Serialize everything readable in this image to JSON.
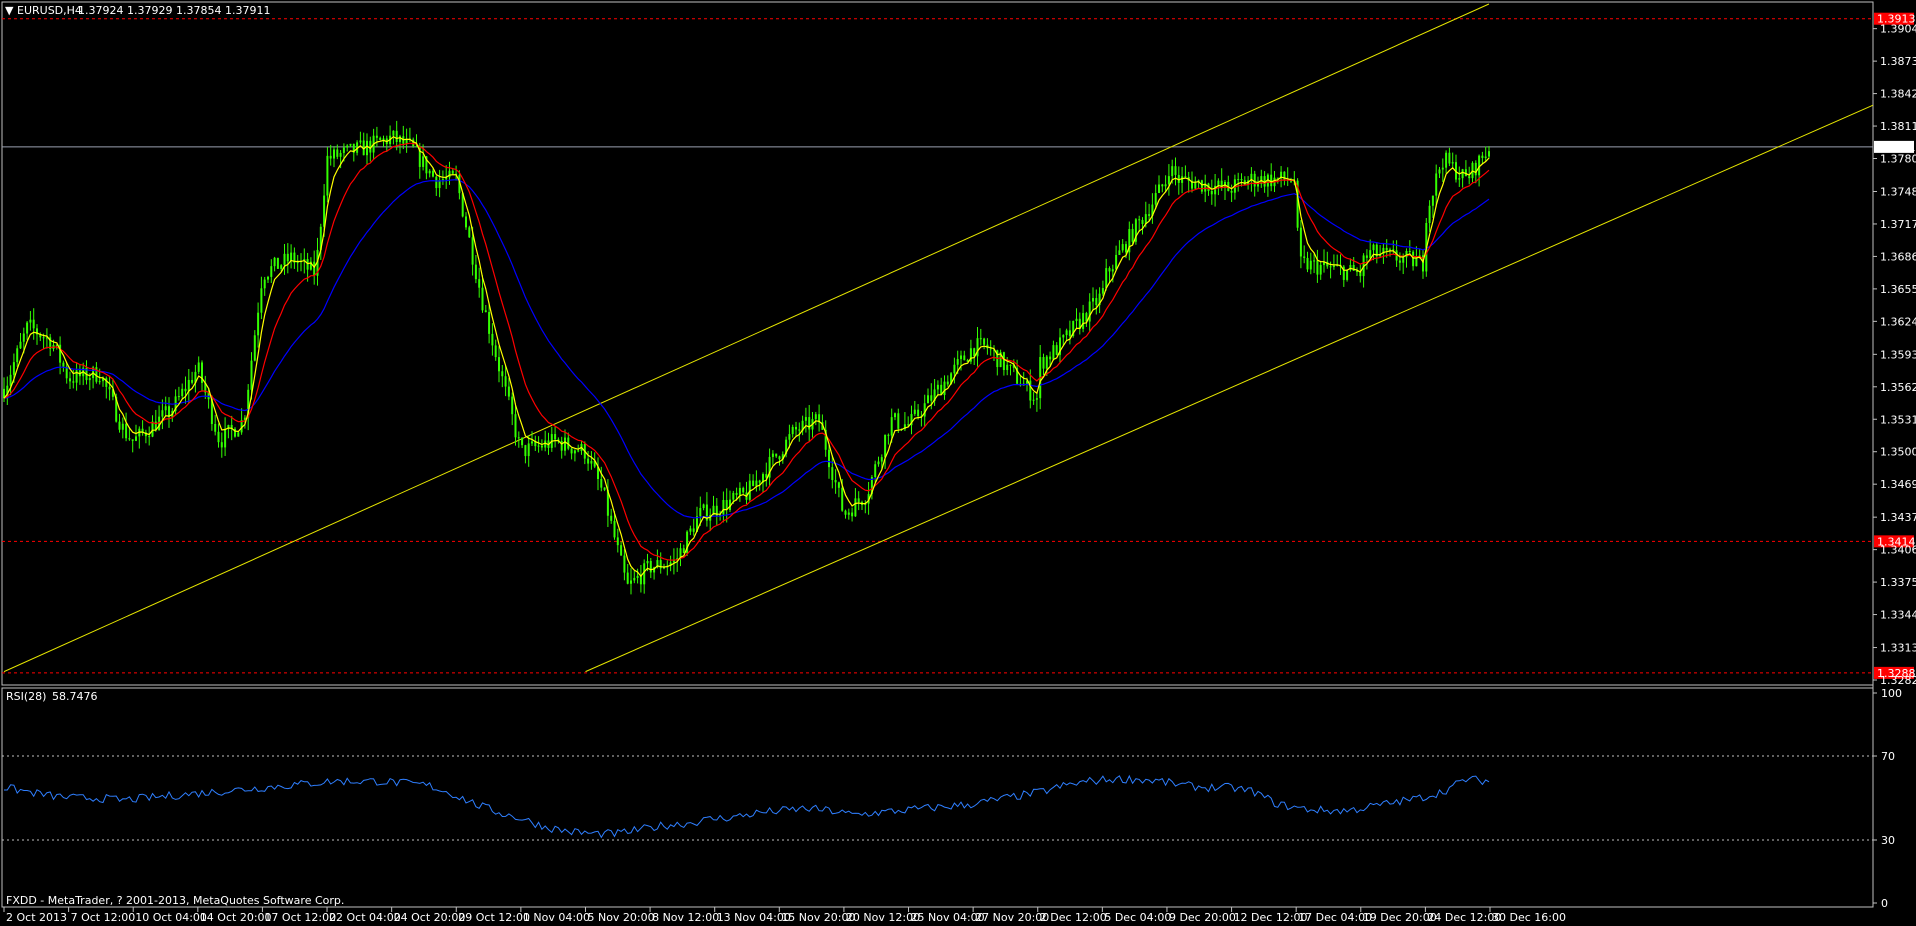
{
  "colors": {
    "background": "#000000",
    "candles": "#33ff00",
    "grid_axis": "#c0c0c0",
    "ma_fast": "#ffff00",
    "ma_mid": "#ff0000",
    "ma_slow": "#0000ff",
    "channel": "#e6e600",
    "rsi": "#2f7fff",
    "hline_red": "#ff0000",
    "price_box": "#ffffff",
    "red_box": "#ff0000"
  },
  "header": {
    "symbol_label": "EURUSD,H4",
    "ohlc_text": "1.37924 1.37929 1.37854 1.37911"
  },
  "rsi_panel": {
    "label": "RSI(28)",
    "value": "58.7476",
    "ticks": [
      "100",
      "70",
      "30",
      "0"
    ],
    "levels": [
      70,
      30
    ]
  },
  "footer_text": "FXDD - MetaTrader, ? 2001-2013, MetaQuotes Software Corp.",
  "chart_data": {
    "type": "candlestick",
    "symbol": "EURUSD",
    "timeframe": "H4",
    "ylim": [
      1.3282,
      1.3918
    ],
    "y_ticks": [
      "1.39040",
      "1.38730",
      "1.38420",
      "1.38110",
      "1.37800",
      "1.37485",
      "1.37175",
      "1.36865",
      "1.36555",
      "1.36245",
      "1.35930",
      "1.35620",
      "1.35310",
      "1.35000",
      "1.34690",
      "1.34375",
      "1.34065",
      "1.33755",
      "1.33445",
      "1.33130",
      "1.32820"
    ],
    "x_ticks": [
      "2 Oct 2013",
      "7 Oct 12:00",
      "10 Oct 04:00",
      "14 Oct 20:00",
      "17 Oct 12:00",
      "22 Oct 04:00",
      "24 Oct 20:00",
      "29 Oct 12:00",
      "1 Nov 04:00",
      "5 Nov 20:00",
      "8 Nov 12:00",
      "13 Nov 04:00",
      "15 Nov 20:00",
      "20 Nov 12:00",
      "25 Nov 04:00",
      "27 Nov 20:00",
      "2 Dec 12:00",
      "5 Dec 04:00",
      "9 Dec 20:00",
      "12 Dec 12:00",
      "17 Dec 04:00",
      "19 Dec 20:00",
      "24 Dec 12:00",
      "30 Dec 16:00"
    ],
    "close_path": [
      [
        "2 Oct 2013",
        1.356
      ],
      [
        "3 Oct 2013",
        1.362
      ],
      [
        "4 Oct 2013",
        1.3605
      ],
      [
        "7 Oct 12:00",
        1.357
      ],
      [
        "8 Oct 2013",
        1.3575
      ],
      [
        "9 Oct 2013",
        1.352
      ],
      [
        "10 Oct 04:00",
        1.351
      ],
      [
        "11 Oct 2013",
        1.354
      ],
      [
        "14 Oct 20:00",
        1.358
      ],
      [
        "15 Oct 2013",
        1.351
      ],
      [
        "16 Oct 2013",
        1.353
      ],
      [
        "17 Oct 12:00",
        1.367
      ],
      [
        "18 Oct 2013",
        1.3685
      ],
      [
        "21 Oct 2013",
        1.367
      ],
      [
        "22 Oct 04:00",
        1.378
      ],
      [
        "23 Oct 2013",
        1.379
      ],
      [
        "24 Oct 20:00",
        1.38
      ],
      [
        "25 Oct 2013",
        1.379
      ],
      [
        "28 Oct 2013",
        1.376
      ],
      [
        "29 Oct 12:00",
        1.376
      ],
      [
        "30 Oct 2013",
        1.364
      ],
      [
        "31 Oct 2013",
        1.355
      ],
      [
        "1 Nov 04:00",
        1.35
      ],
      [
        "4 Nov 2013",
        1.351
      ],
      [
        "5 Nov 20:00",
        1.35
      ],
      [
        "6 Nov 2013",
        1.346
      ],
      [
        "7 Nov 2013",
        1.337
      ],
      [
        "8 Nov 12:00",
        1.339
      ],
      [
        "11 Nov 2013",
        1.3395
      ],
      [
        "12 Nov 2013",
        1.344
      ],
      [
        "13 Nov 04:00",
        1.3445
      ],
      [
        "14 Nov 2013",
        1.346
      ],
      [
        "15 Nov 20:00",
        1.35
      ],
      [
        "18 Nov 2013",
        1.352
      ],
      [
        "19 Nov 2013",
        1.353
      ],
      [
        "20 Nov 12:00",
        1.344
      ],
      [
        "21 Nov 2013",
        1.346
      ],
      [
        "22 Nov 2013",
        1.353
      ],
      [
        "25 Nov 04:00",
        1.3525
      ],
      [
        "26 Nov 2013",
        1.356
      ],
      [
        "27 Nov 20:00",
        1.36
      ],
      [
        "28 Nov 2013",
        1.36
      ],
      [
        "2 Dec 12:00",
        1.355
      ],
      [
        "3 Dec 2013",
        1.358
      ],
      [
        "4 Dec 2013",
        1.36
      ],
      [
        "5 Dec 04:00",
        1.365
      ],
      [
        "6 Dec 2013",
        1.367
      ],
      [
        "9 Dec 20:00",
        1.376
      ],
      [
        "10 Dec 2013",
        1.379
      ],
      [
        "11 Dec 2013",
        1.376
      ],
      [
        "12 Dec 12:00",
        1.375
      ],
      [
        "13 Dec 2013",
        1.375
      ],
      [
        "16 Dec 2013",
        1.376
      ],
      [
        "17 Dec 04:00",
        1.376
      ],
      [
        "18 Dec 2013",
        1.368
      ],
      [
        "19 Dec 20:00",
        1.367
      ],
      [
        "20 Dec 2013",
        1.366
      ],
      [
        "23 Dec 2013",
        1.369
      ],
      [
        "24 Dec 12:00",
        1.368
      ],
      [
        "26 Dec 2013",
        1.37
      ],
      [
        "27 Dec 2013",
        1.378
      ],
      [
        "30 Dec 2013",
        1.376
      ],
      [
        "30 Dec 16:00",
        1.37911
      ]
    ],
    "rsi_path": [
      55,
      53,
      51,
      50,
      50,
      49,
      50,
      51,
      52,
      53,
      54,
      55,
      56,
      57,
      58,
      58,
      58,
      57,
      56,
      52,
      47,
      43,
      40,
      36,
      34,
      33,
      33,
      35,
      37,
      38,
      40,
      41,
      43,
      44,
      45,
      44,
      42,
      43,
      44,
      45,
      46,
      47,
      49,
      51,
      53,
      56,
      58,
      59,
      59,
      58,
      56,
      55,
      55,
      53,
      47,
      45,
      44,
      44,
      46,
      48,
      50,
      53,
      59,
      58
    ],
    "current_price": "1.37911",
    "red_levels": [
      {
        "label": "1.39135",
        "value": 1.39135
      },
      {
        "label": "1.34144",
        "value": 1.34144
      },
      {
        "label": "1.32888",
        "value": 1.32888
      }
    ],
    "channel": {
      "upper": [
        [
          "2 Oct 2013",
          1.329
        ],
        [
          "8 Nov 12:00",
          1.3543
        ],
        [
          "30 Dec 16:00",
          1.3928
        ]
      ],
      "lower": [
        [
          "5 Nov 20:00",
          1.329
        ],
        [
          "30 Dec 16:00",
          1.367
        ]
      ]
    }
  }
}
